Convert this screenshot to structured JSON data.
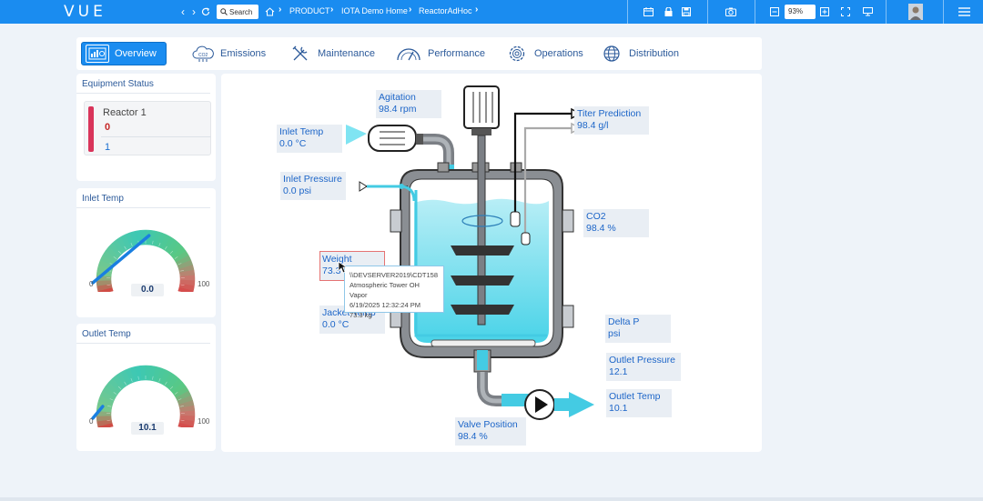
{
  "app": {
    "logo": "VUE",
    "search_label": "Search",
    "breadcrumbs": [
      "PRODUCT",
      "IOTA Demo Home",
      "ReactorAdHoc"
    ],
    "zoom": "93%"
  },
  "tabs": [
    {
      "label": "Overview",
      "active": true,
      "icon": "overview-icon"
    },
    {
      "label": "Emissions",
      "active": false,
      "icon": "co2-cloud-icon"
    },
    {
      "label": "Maintenance",
      "active": false,
      "icon": "tools-icon"
    },
    {
      "label": "Performance",
      "active": false,
      "icon": "speedometer-icon"
    },
    {
      "label": "Operations",
      "active": false,
      "icon": "gear-icon"
    },
    {
      "label": "Distribution",
      "active": false,
      "icon": "globe-icon"
    }
  ],
  "equipment_status": {
    "title": "Equipment Status",
    "name": "Reactor 1",
    "value_primary": "0",
    "value_secondary": "1"
  },
  "inlet_gauge": {
    "title": "Inlet Temp",
    "min": "0",
    "max": "100",
    "value": "0.0",
    "fraction": 0.0
  },
  "outlet_gauge": {
    "title": "Outlet Temp",
    "min": "0",
    "max": "100",
    "value": "10.1",
    "fraction": 0.101
  },
  "diagram": {
    "agitation": {
      "label": "Agitation",
      "value": "98.4 rpm"
    },
    "inlet_temp": {
      "label": "Inlet Temp",
      "value": "0.0 °C"
    },
    "inlet_pressure": {
      "label": "Inlet Pressure",
      "value": "0.0 psi"
    },
    "weight": {
      "label": "Weight",
      "value": "73.3 kg"
    },
    "jacket_temp": {
      "label": "Jacket Temp",
      "value": "0.0 °C"
    },
    "titer": {
      "label": "Titer Prediction",
      "value": "98.4 g/l"
    },
    "co2": {
      "label": "CO2",
      "value": "98.4 %"
    },
    "delta_p": {
      "label": "Delta P",
      "value": "psi"
    },
    "outlet_pressure": {
      "label": "Outlet Pressure",
      "value": "12.1"
    },
    "outlet_temp": {
      "label": "Outlet Temp",
      "value": "10.1"
    },
    "valve_position": {
      "label": "Valve Position",
      "value": "98.4 %"
    }
  },
  "tooltip": {
    "line1": "\\\\DEVSERVER2019\\CDT158",
    "line2": "Atmospheric Tower OH Vapor",
    "line3": "6/19/2025 12:32:24 PM",
    "line4": "73.3 kg"
  },
  "colors": {
    "brand": "#1a8cf0",
    "fluid": "#4dd2e6",
    "alarm": "#d9345a"
  }
}
